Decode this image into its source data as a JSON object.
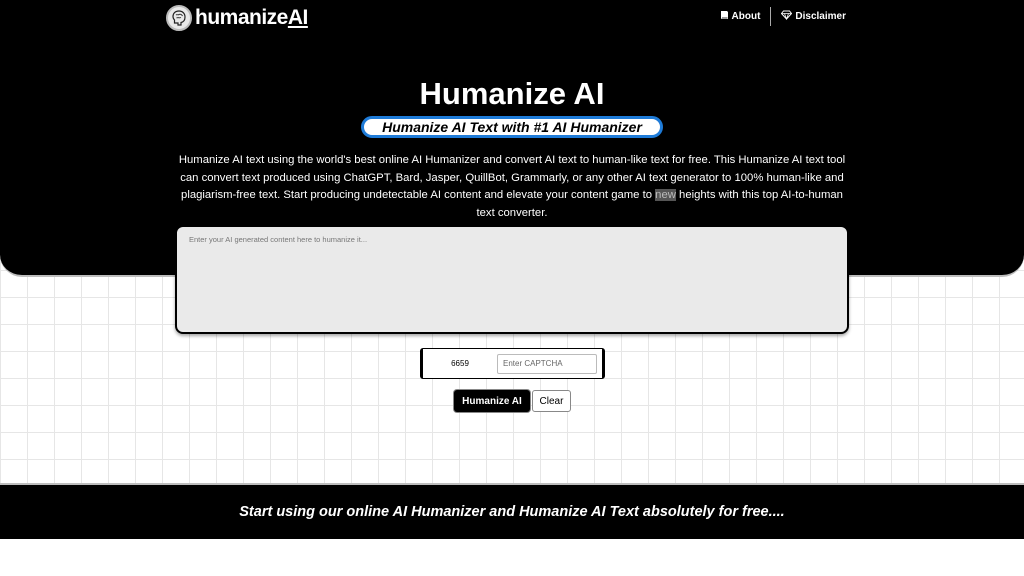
{
  "nav": {
    "logo_text_main": "humanize",
    "logo_text_ai": "AI",
    "about_label": "About",
    "disclaimer_label": "Disclaimer"
  },
  "hero": {
    "title": "Humanize AI",
    "badge": "Humanize AI Text with #1 AI Humanizer",
    "description_before": "Humanize AI text using the world's best online AI Humanizer and convert AI text to human-like text for free. This Humanize AI text tool can convert text produced using ChatGPT, Bard, Jasper, QuillBot, Grammarly, or any other AI text generator to 100% human-like and plagiarism-free text. Start producing undetectable AI content and elevate your content game to ",
    "description_highlight": "new",
    "description_after": " heights with this top AI-to-human text converter."
  },
  "editor": {
    "placeholder": "Enter your AI generated content here to humanize it..."
  },
  "captcha": {
    "code": "6659",
    "placeholder": "Enter CAPTCHA"
  },
  "actions": {
    "humanize_label": "Humanize AI",
    "clear_label": "Clear"
  },
  "footer": {
    "tagline": "Start using our online AI Humanizer and Humanize AI Text absolutely for free...."
  },
  "colors": {
    "accent": "#1e7bd8",
    "hero_bg": "#000000",
    "editor_bg": "#eaeaea"
  },
  "icons": {
    "logo": "brain-logo-icon",
    "about": "book-icon",
    "disclaimer": "diamond-icon"
  }
}
